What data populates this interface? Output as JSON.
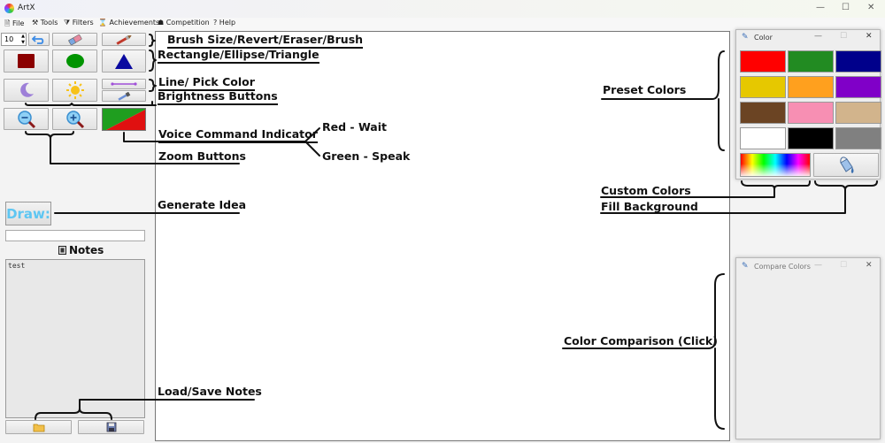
{
  "window": {
    "title": "ArtX",
    "min": "—",
    "max": "☐",
    "close": "✕"
  },
  "menu": [
    {
      "icon": "🗎",
      "label": "File"
    },
    {
      "icon": "⚒",
      "label": "Tools"
    },
    {
      "icon": "⧩",
      "label": "Filters"
    },
    {
      "icon": "⌛",
      "label": "Achievements"
    },
    {
      "icon": "☗",
      "label": "Competition"
    },
    {
      "icon": "?",
      "label": "Help"
    }
  ],
  "toolbar": {
    "brush_size": "10",
    "draw_label": "Draw:"
  },
  "notes": {
    "title": "Notes",
    "text": "test"
  },
  "annotations": {
    "brush": "Brush Size/Revert/Eraser/Brush",
    "shapes": "Rectangle/Ellipse/Triangle",
    "line": "Line/ Pick Color",
    "brightness": "Brightness Buttons",
    "voice": "Voice Command Indicator",
    "red": "Red - Wait",
    "green": "Green - Speak",
    "zoom": "Zoom Buttons",
    "idea": "Generate Idea",
    "load_save": "Load/Save Notes",
    "preset": "Preset Colors",
    "custom": "Custom Colors",
    "fill": "Fill Background",
    "compare": "Color Comparison (Click)"
  },
  "color_window": {
    "title": "Color",
    "presets": [
      "#ff0000",
      "#228b22",
      "#00008b",
      "#e6c800",
      "#ffa01e",
      "#8000c8",
      "#6b4423",
      "#f78fb3",
      "#d2b48c",
      "#ffffff",
      "#000000",
      "#808080"
    ]
  },
  "compare_window": {
    "title": "Compare Colors"
  }
}
